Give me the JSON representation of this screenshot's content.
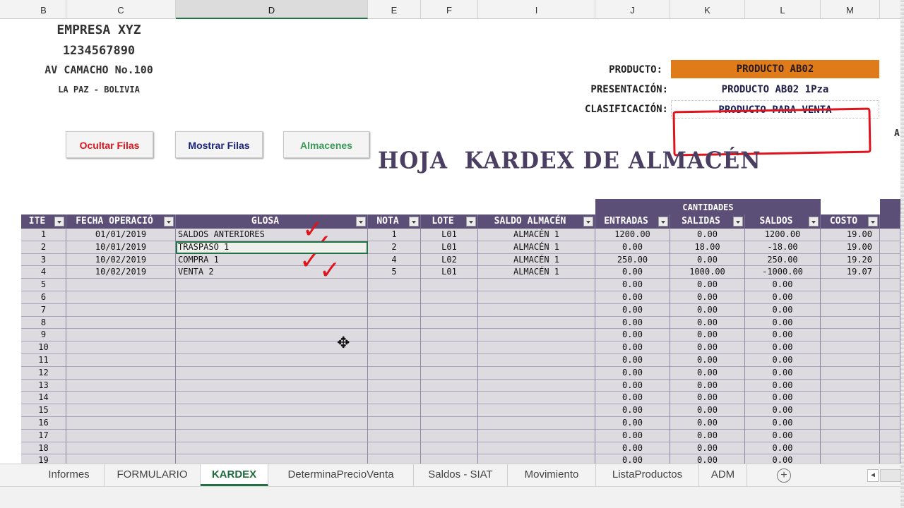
{
  "column_headers": [
    "B",
    "C",
    "D",
    "E",
    "F",
    "I",
    "J",
    "K",
    "L",
    "M"
  ],
  "company": {
    "name": "EMPRESA XYZ",
    "nit": "1234567890",
    "address": "AV CAMACHO No.100",
    "city": "LA PAZ - BOLIVIA"
  },
  "product_info": {
    "product_label": "PRODUCTO:",
    "product_value": "PRODUCTO AB02",
    "presentation_label": "PRESENTACIÓN:",
    "presentation_value": "PRODUCTO AB02 1Pza",
    "classification_label": "CLASIFICACIÓN:",
    "classification_value": "PRODUCTO PARA VENTA",
    "right_stub": "A"
  },
  "buttons": {
    "hide_rows": "Ocultar Filas",
    "show_rows": "Mostrar Filas",
    "warehouses": "Almacenes"
  },
  "sheet_title": "HOJA  KARDEX DE ALMACÉN",
  "table": {
    "group_header": "CANTIDADES",
    "headers": [
      "ITE",
      "FECHA OPERACIÓ",
      "GLOSA",
      "NOTA",
      "LOTE",
      "SALDO ALMACÉN",
      "ENTRADAS",
      "SALIDAS",
      "SALDOS",
      "COSTO"
    ],
    "rows": [
      [
        "1",
        "01/01/2019",
        "SALDOS ANTERIORES",
        "1",
        "L01",
        "ALMACÉN 1",
        "1200.00",
        "0.00",
        "1200.00",
        "19.00"
      ],
      [
        "2",
        "10/01/2019",
        "TRASPASO 1",
        "2",
        "L01",
        "ALMACÉN 1",
        "0.00",
        "18.00",
        "-18.00",
        "19.00"
      ],
      [
        "3",
        "10/02/2019",
        "COMPRA 1",
        "4",
        "L02",
        "ALMACÉN 1",
        "250.00",
        "0.00",
        "250.00",
        "19.20"
      ],
      [
        "4",
        "10/02/2019",
        "VENTA 2",
        "5",
        "L01",
        "ALMACÉN 1",
        "0.00",
        "1000.00",
        "-1000.00",
        "19.07"
      ],
      [
        "5",
        "",
        "",
        "",
        "",
        "",
        "0.00",
        "0.00",
        "0.00",
        ""
      ],
      [
        "6",
        "",
        "",
        "",
        "",
        "",
        "0.00",
        "0.00",
        "0.00",
        ""
      ],
      [
        "7",
        "",
        "",
        "",
        "",
        "",
        "0.00",
        "0.00",
        "0.00",
        ""
      ],
      [
        "8",
        "",
        "",
        "",
        "",
        "",
        "0.00",
        "0.00",
        "0.00",
        ""
      ],
      [
        "9",
        "",
        "",
        "",
        "",
        "",
        "0.00",
        "0.00",
        "0.00",
        ""
      ],
      [
        "10",
        "",
        "",
        "",
        "",
        "",
        "0.00",
        "0.00",
        "0.00",
        ""
      ],
      [
        "11",
        "",
        "",
        "",
        "",
        "",
        "0.00",
        "0.00",
        "0.00",
        ""
      ],
      [
        "12",
        "",
        "",
        "",
        "",
        "",
        "0.00",
        "0.00",
        "0.00",
        ""
      ],
      [
        "13",
        "",
        "",
        "",
        "",
        "",
        "0.00",
        "0.00",
        "0.00",
        ""
      ],
      [
        "14",
        "",
        "",
        "",
        "",
        "",
        "0.00",
        "0.00",
        "0.00",
        ""
      ],
      [
        "15",
        "",
        "",
        "",
        "",
        "",
        "0.00",
        "0.00",
        "0.00",
        ""
      ],
      [
        "16",
        "",
        "",
        "",
        "",
        "",
        "0.00",
        "0.00",
        "0.00",
        ""
      ],
      [
        "17",
        "",
        "",
        "",
        "",
        "",
        "0.00",
        "0.00",
        "0.00",
        ""
      ],
      [
        "18",
        "",
        "",
        "",
        "",
        "",
        "0.00",
        "0.00",
        "0.00",
        ""
      ],
      [
        "19",
        "",
        "",
        "",
        "",
        "",
        "0.00",
        "0.00",
        "0.00",
        ""
      ]
    ],
    "active_cell": "GLOSA row 2"
  },
  "annotations": {
    "check_glyph": "✓",
    "cursor_glyph": "✥"
  },
  "tabs": [
    "Informes",
    "FORMULARIO",
    "KARDEX",
    "DeterminaPrecioVenta",
    "Saldos - SIAT",
    "Movimiento",
    "ListaProductos",
    "ADM"
  ],
  "active_tab": "KARDEX",
  "tab_controls": {
    "add_sheet": "+",
    "scroll_left": "◀"
  },
  "colors": {
    "header_purple": "#5c4f77",
    "product_orange": "#e07b1a",
    "annotation_red": "#e0141c",
    "excel_green": "#217346",
    "hide_rows_text": "#e0141c",
    "show_rows_text": "#1a237e",
    "warehouses_text": "#3a9a5a"
  }
}
